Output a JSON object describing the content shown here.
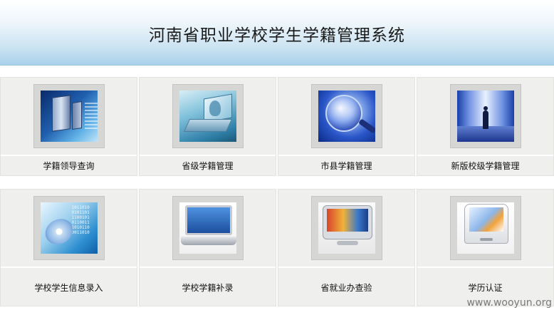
{
  "header": {
    "title": "河南省职业学校学生学籍管理系统"
  },
  "row1": [
    {
      "label": "学籍领导查询",
      "icon": "server-tower-icon"
    },
    {
      "label": "省级学籍管理",
      "icon": "laptop-person-icon"
    },
    {
      "label": "市县学籍管理",
      "icon": "magnifier-icon"
    },
    {
      "label": "新版校级学籍管理",
      "icon": "corridor-person-icon"
    }
  ],
  "row2": [
    {
      "label": "学校学生信息录入",
      "icon": "cd-binary-icon"
    },
    {
      "label": "学校学籍补录",
      "icon": "powerbook-icon"
    },
    {
      "label": "省就业办查验",
      "icon": "imac-monitor-icon"
    },
    {
      "label": "学历认证",
      "icon": "emac-computer-icon"
    }
  ],
  "watermark": "www.wooyun.org"
}
